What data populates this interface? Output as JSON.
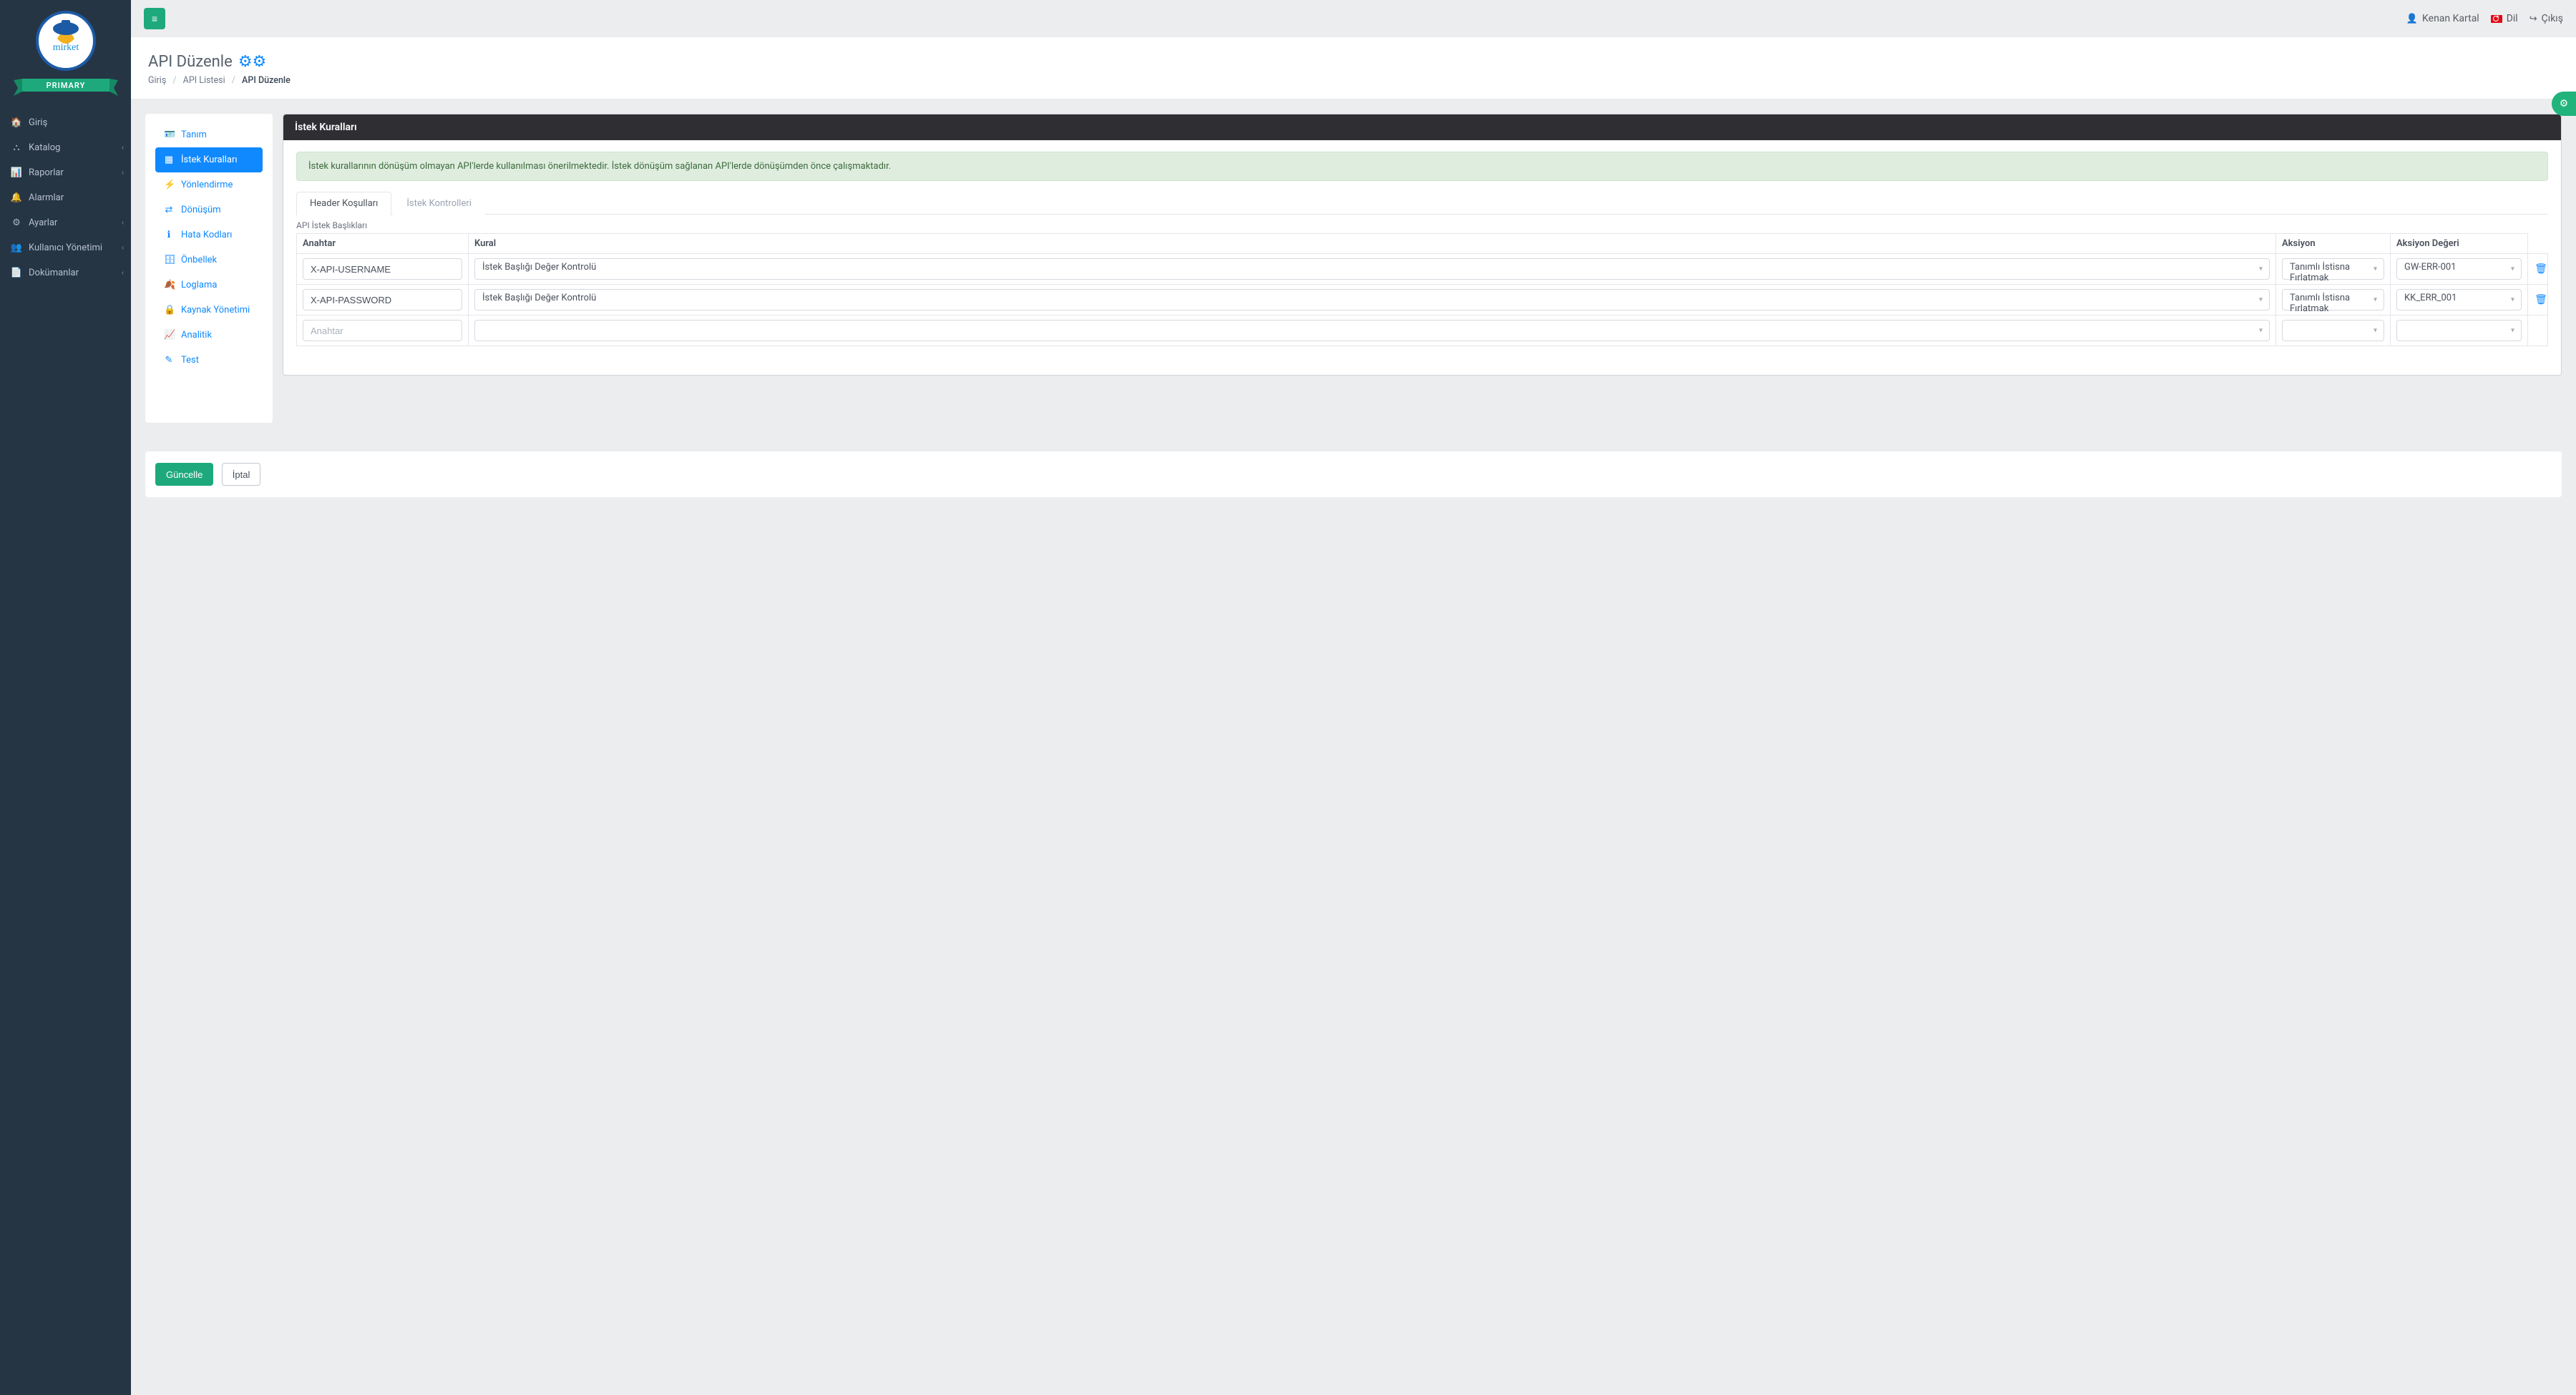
{
  "brand": {
    "badge": "PRIMARY"
  },
  "sidebar": {
    "items": [
      {
        "label": "Giriş",
        "chevron": false
      },
      {
        "label": "Katalog",
        "chevron": true
      },
      {
        "label": "Raporlar",
        "chevron": true
      },
      {
        "label": "Alarmlar",
        "chevron": false
      },
      {
        "label": "Ayarlar",
        "chevron": true
      },
      {
        "label": "Kullanıcı Yönetimi",
        "chevron": true
      },
      {
        "label": "Dokümanlar",
        "chevron": true
      }
    ]
  },
  "topbar": {
    "user_name": "Kenan Kartal",
    "lang_label": "Dil",
    "logout_label": "Çıkış"
  },
  "header": {
    "title": "API Düzenle",
    "breadcrumb": {
      "home": "Giriş",
      "list": "API Listesi",
      "current": "API Düzenle"
    }
  },
  "left_nav": {
    "items": [
      {
        "label": "Tanım"
      },
      {
        "label": "İstek Kuralları"
      },
      {
        "label": "Yönlendirme"
      },
      {
        "label": "Dönüşüm"
      },
      {
        "label": "Hata Kodları"
      },
      {
        "label": "Önbellek"
      },
      {
        "label": "Loglama"
      },
      {
        "label": "Kaynak Yönetimi"
      },
      {
        "label": "Analitik"
      },
      {
        "label": "Test"
      }
    ],
    "active_index": 1
  },
  "panel": {
    "title": "İstek Kuralları",
    "info": "İstek kurallarının dönüşüm olmayan API'lerde kullanılması önerilmektedir. İstek dönüşüm sağlanan API'lerde dönüşümden önce çalışmaktadır."
  },
  "tabs": {
    "items": [
      {
        "label": "Header Koşulları"
      },
      {
        "label": "İstek Kontrolleri"
      }
    ],
    "active_index": 0
  },
  "table": {
    "section_title": "API İstek Başlıkları",
    "columns": {
      "key": "Anahtar",
      "rule": "Kural",
      "action": "Aksiyon",
      "action_value": "Aksiyon Değeri"
    },
    "placeholder_key": "Anahtar",
    "rows": [
      {
        "key": "X-API-USERNAME",
        "rule": "İstek Başlığı Değer Kontrolü",
        "action": "Tanımlı İstisna Fırlatmak",
        "action_value": "GW-ERR-001"
      },
      {
        "key": "X-API-PASSWORD",
        "rule": "İstek Başlığı Değer Kontrolü",
        "action": "Tanımlı İstisna Fırlatmak",
        "action_value": "KK_ERR_001"
      }
    ]
  },
  "footer": {
    "save_label": "Güncelle",
    "cancel_label": "İptal"
  }
}
